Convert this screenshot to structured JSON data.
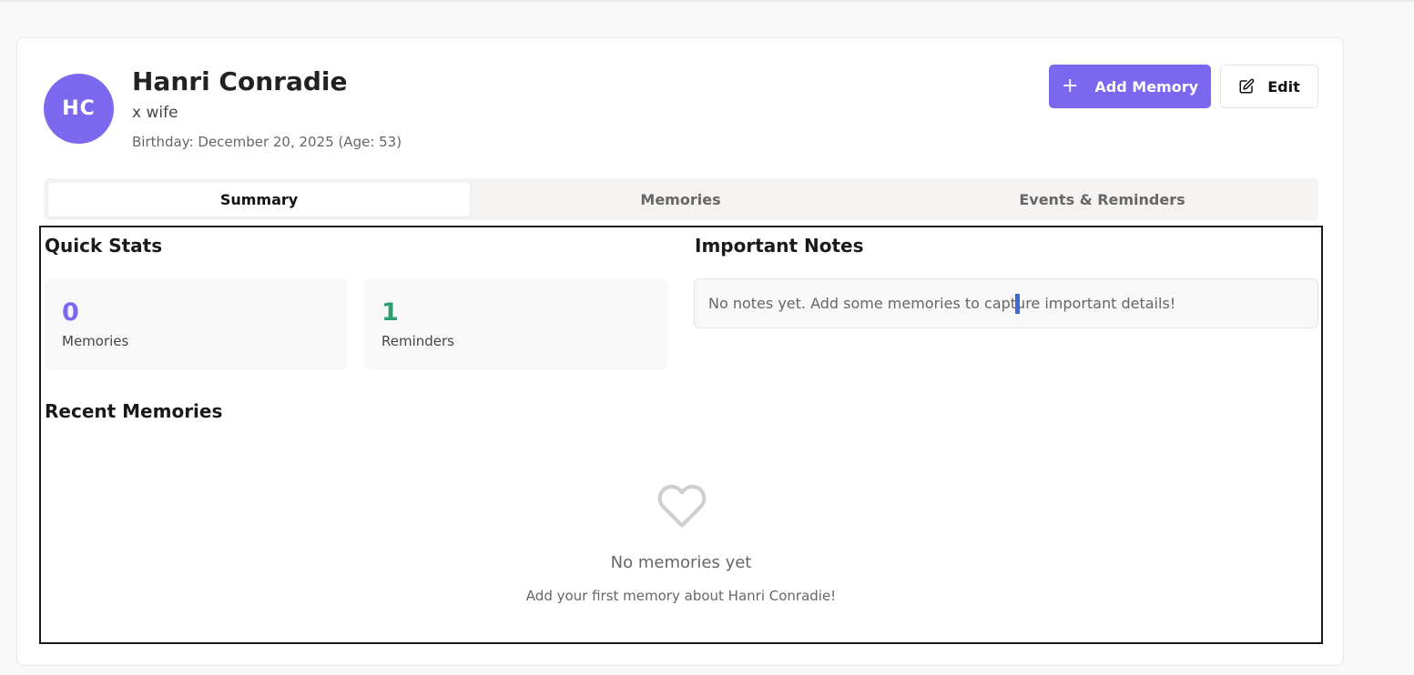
{
  "profile": {
    "initials": "HC",
    "name": "Hanri Conradie",
    "relation": "x wife",
    "birthday": "Birthday: December 20, 2025 (Age: 53)",
    "avatar_color": "#7b68ee"
  },
  "actions": {
    "add_memory_label": "Add Memory",
    "edit_label": "Edit"
  },
  "tabs": [
    {
      "label": "Summary",
      "active": true
    },
    {
      "label": "Memories",
      "active": false
    },
    {
      "label": "Events & Reminders",
      "active": false
    }
  ],
  "quick_stats": {
    "title": "Quick Stats",
    "memories_count": "0",
    "memories_label": "Memories",
    "reminders_count": "1",
    "reminders_label": "Reminders"
  },
  "important_notes": {
    "title": "Important Notes",
    "empty_text": "No notes yet. Add some memories to capture important details!"
  },
  "recent_memories": {
    "title": "Recent Memories",
    "empty_title": "No memories yet",
    "empty_subtitle": "Add your first memory about Hanri Conradie!",
    "icon": "heart-icon"
  },
  "colors": {
    "accent": "#7b68ee",
    "reminders": "#2e9e6e"
  }
}
